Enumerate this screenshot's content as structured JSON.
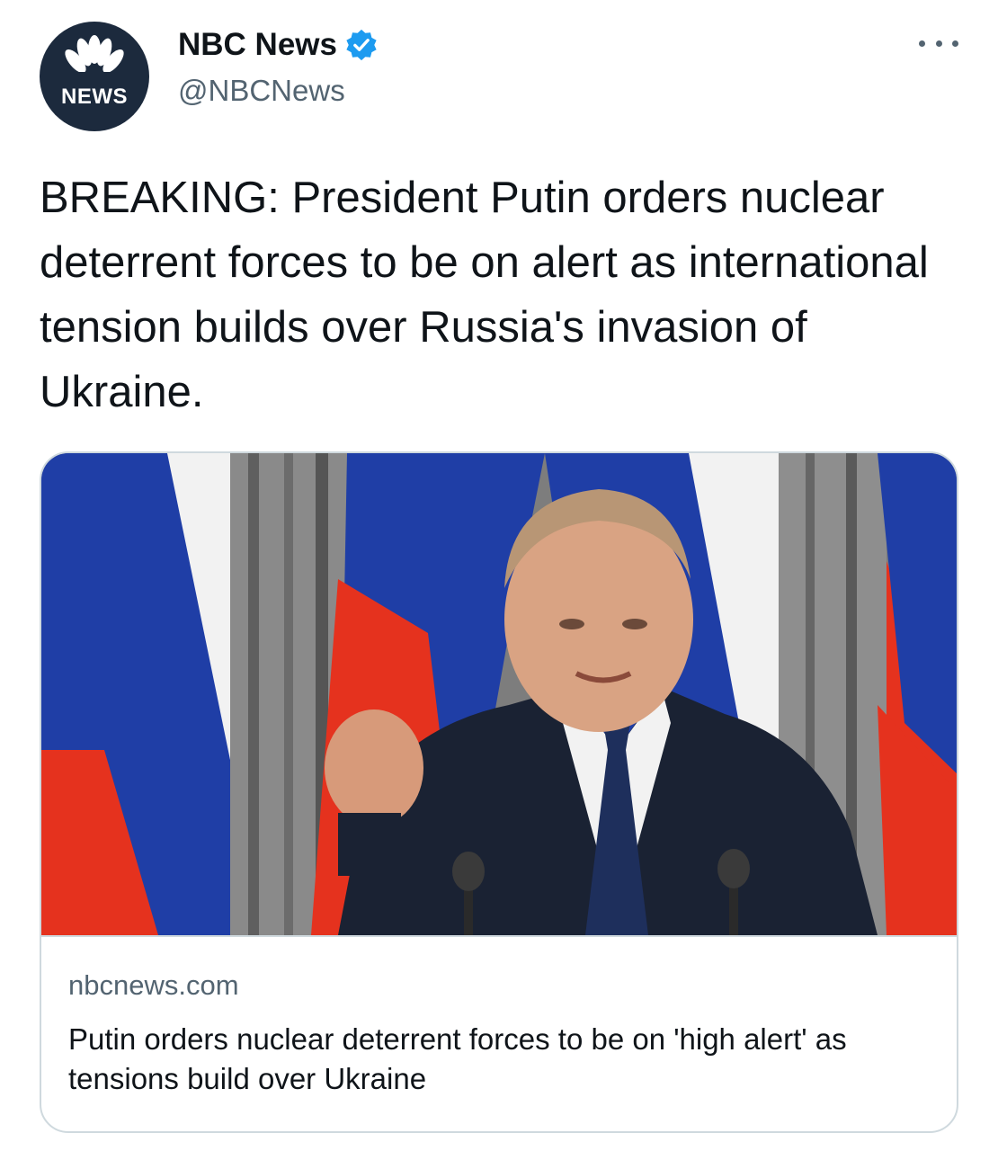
{
  "author": {
    "display_name": "NBC News",
    "handle": "@NBCNews",
    "avatar_label": "NEWS",
    "verified": true,
    "avatar_bg": "#1c2a3d"
  },
  "tweet": {
    "text": "BREAKING: President Putin orders nuclear deterrent forces to be on alert as international tension builds over Russia's invasion of Ukraine."
  },
  "card": {
    "domain": "nbcnews.com",
    "title": "Putin orders nuclear deterrent forces to be on 'high alert' as tensions build over Ukraine"
  },
  "icons": {
    "more": "more-horizontal-icon",
    "verified": "verified-badge-icon"
  },
  "colors": {
    "accent": "#1d9bf0",
    "text": "#0f1419",
    "secondary": "#536471",
    "border": "#cfd9de",
    "flag_white": "#f2f2f2",
    "flag_blue": "#1f3ea6",
    "flag_red": "#e5321e"
  }
}
